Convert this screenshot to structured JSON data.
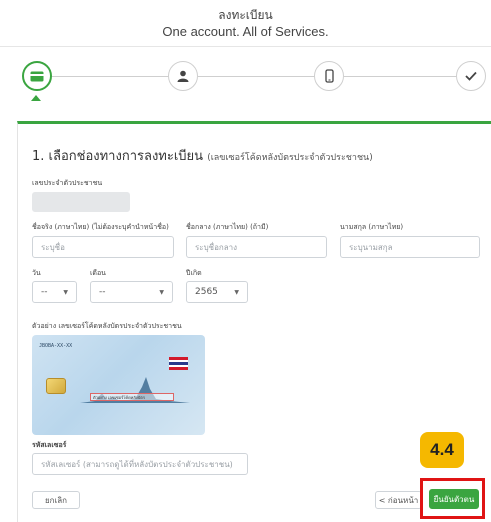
{
  "header": {
    "title": "ลงทะเบียน",
    "subtitle": "One account. All of Services."
  },
  "stepper": {
    "steps": [
      "card-icon",
      "user-icon",
      "phone-icon",
      "check-icon"
    ],
    "active_step": 1,
    "accent": "#3aa540"
  },
  "form": {
    "section_title": "1. เลือกช่องทางการลงทะเบียน",
    "section_hint": "(เลขเซอร์โค้ดหลังบัตรประจำตัวประชาชน)",
    "citizen_id": {
      "label": "เลขประจำตัวประชาชน",
      "value": ""
    },
    "first_name": {
      "label": "ชื่อจริง (ภาษาไทย) (ไม่ต้องระบุคำนำหน้าชื่อ)",
      "placeholder": "ระบุชื่อ"
    },
    "middle_name": {
      "label": "ชื่อกลาง (ภาษาไทย) (ถ้ามี)",
      "placeholder": "ระบุชื่อกลาง"
    },
    "last_name": {
      "label": "นามสกุล (ภาษาไทย)",
      "placeholder": "ระบุนามสกุล"
    },
    "day": {
      "label": "วัน",
      "value": "--"
    },
    "month": {
      "label": "เดือน",
      "value": "--"
    },
    "year": {
      "label": "ปีเกิด",
      "value": "2565"
    },
    "example_label": "ตัวอย่าง เลขเซอร์โค้ดหลังบัตรประจำตัวประชาชน",
    "laser_code": {
      "label": "รหัสเลเซอร์",
      "placeholder": "รหัสเลเซอร์ (สามารถดูได้ที่หลังบัตรประจำตัวประชาชน)"
    }
  },
  "id_card_sample": {
    "code_text": "JBOBA-XX-XX",
    "number_text": "ตัวอย่าง เลขเซอร์โค้ดหลังบัตร"
  },
  "buttons": {
    "cancel": "ยกเลิก",
    "back": "< ก่อนหน้า",
    "confirm": "ยืนยันตัวตน"
  },
  "annotation": {
    "badge": "4.4",
    "badge_color": "#f5b800",
    "highlight_color": "#e01414"
  }
}
